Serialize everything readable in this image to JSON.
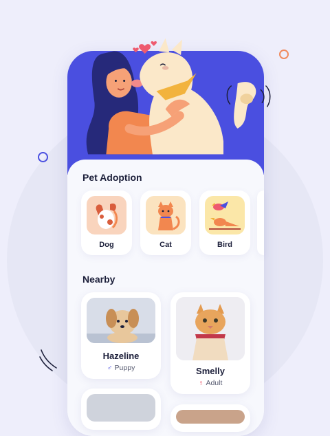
{
  "sections": {
    "adoption_title": "Pet Adoption",
    "nearby_title": "Nearby"
  },
  "categories": [
    {
      "label": "Dog",
      "icon": "dog-icon"
    },
    {
      "label": "Cat",
      "icon": "cat-icon"
    },
    {
      "label": "Bird",
      "icon": "bird-icon"
    }
  ],
  "pets": [
    {
      "name": "Hazeline",
      "gender": "♂",
      "age": "Puppy"
    },
    {
      "name": "Smelly",
      "gender": "♀",
      "age": "Adult"
    }
  ],
  "colors": {
    "accent": "#4a4fe0",
    "background": "#eeeefb",
    "male": "#4a4fe0",
    "female": "#ee5a6f",
    "hero": "#4a4fe0"
  }
}
